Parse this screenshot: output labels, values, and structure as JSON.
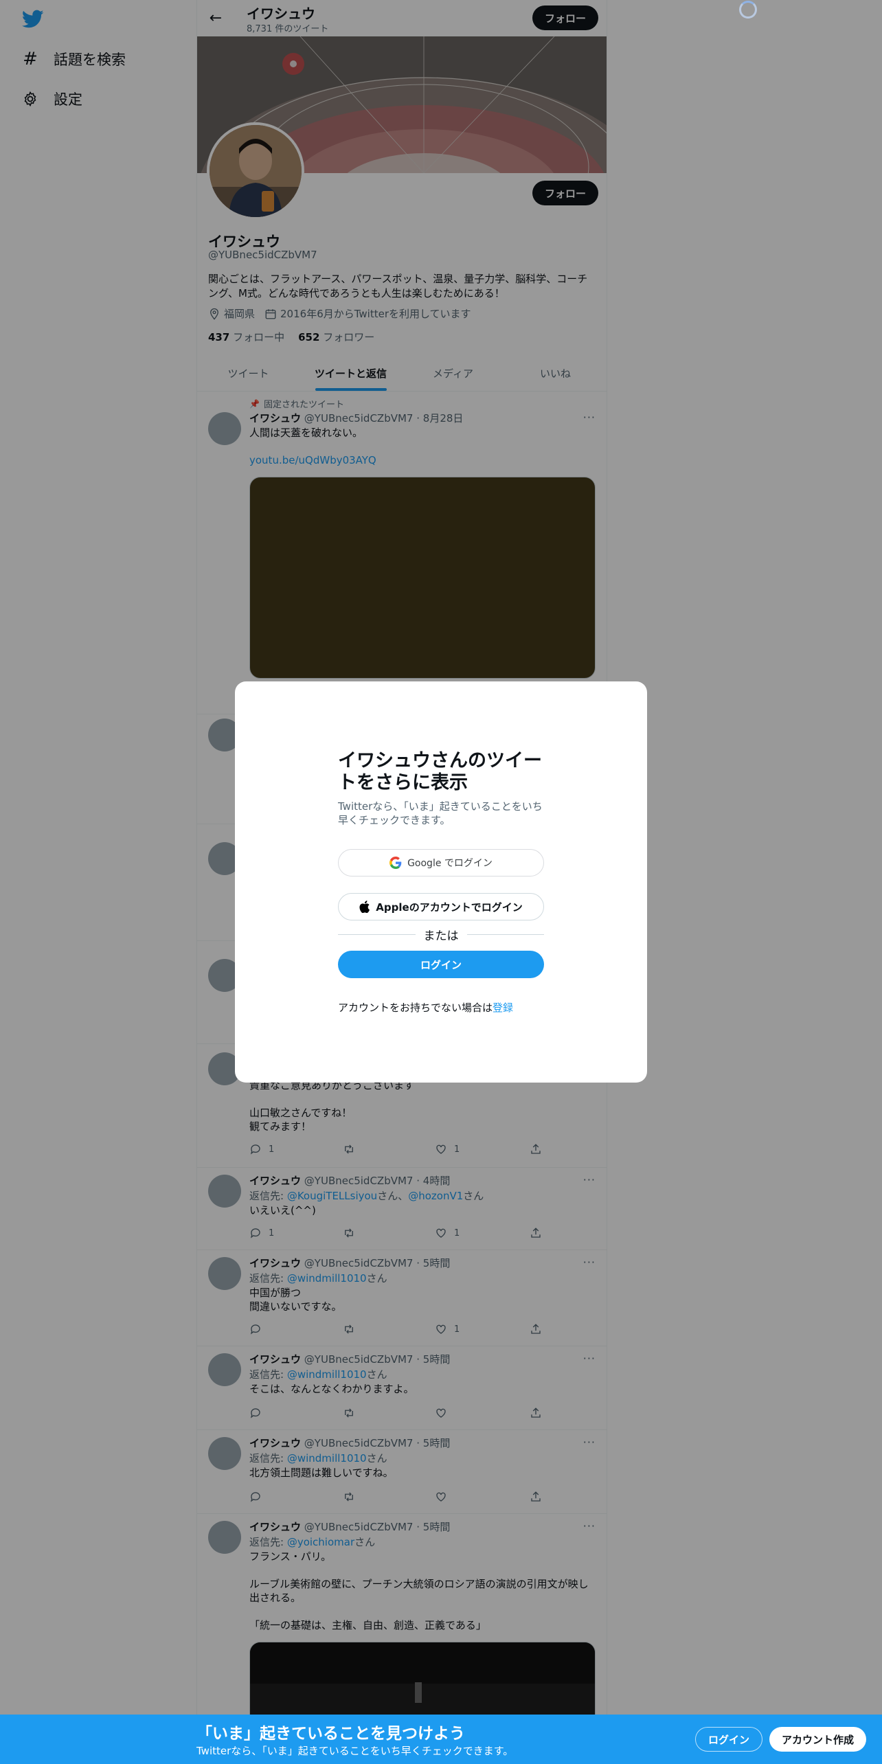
{
  "sidebar": {
    "items": [
      {
        "icon": "hashtag-icon",
        "label": "話題を検索"
      },
      {
        "icon": "gear-icon",
        "label": "設定"
      }
    ]
  },
  "header": {
    "name": "イワシュウ",
    "tweet_count": "8,731 件のツイート",
    "follow_label": "フォロー"
  },
  "profile": {
    "name": "イワシュウ",
    "handle": "@YUBnec5idCZbVM7",
    "bio": "関心ごとは、フラットアース、パワースポット、温泉、量子力学、脳科学、コーチング、M式。どんな時代であろうとも人生は楽しむためにある！",
    "location": "福岡県",
    "joined": "2016年6月からTwitterを利用しています",
    "following_count": "437",
    "following_label": "フォロー中",
    "followers_count": "652",
    "followers_label": "フォロワー",
    "follow_label": "フォロー"
  },
  "tabs": [
    {
      "label": "ツイート",
      "active": false
    },
    {
      "label": "ツイートと返信",
      "active": true
    },
    {
      "label": "メディア",
      "active": false
    },
    {
      "label": "いいね",
      "active": false
    }
  ],
  "pinned_label": "固定されたツイート",
  "pinned_tweet": {
    "name": "イワシュウ",
    "handle": "@YUBnec5idCZbVM7",
    "time": "8月28日",
    "text": "人間は天蓋を破れない。",
    "link": "youtu.be/uQdWby03AYQ"
  },
  "tweet_partial": {
    "text": "貴重なご意見ありがとうございます\n\n山口敏之さんですね！\n観てみます！",
    "reply_count": "1",
    "like_count": "1"
  },
  "tweets": [
    {
      "name": "イワシュウ",
      "handle": "@YUBnec5idCZbVM7",
      "time": "4時間",
      "reply_prefix": "返信先: ",
      "reply_to_1": "@KougiTELLsiyou",
      "reply_mid": "さん、",
      "reply_to_2": "@hozonV1",
      "reply_suffix": "さん",
      "text": "いえいえ(^^)",
      "reply_count": "1",
      "like_count": "1"
    },
    {
      "name": "イワシュウ",
      "handle": "@YUBnec5idCZbVM7",
      "time": "5時間",
      "reply_prefix": "返信先: ",
      "reply_to_1": "@windmill1010",
      "reply_suffix": "さん",
      "text": "中国が勝つ\n間違いないですな。",
      "reply_count": "",
      "like_count": "1"
    },
    {
      "name": "イワシュウ",
      "handle": "@YUBnec5idCZbVM7",
      "time": "5時間",
      "reply_prefix": "返信先: ",
      "reply_to_1": "@windmill1010",
      "reply_suffix": "さん",
      "text": "そこは、なんとなくわかりますよ。",
      "reply_count": "",
      "like_count": ""
    },
    {
      "name": "イワシュウ",
      "handle": "@YUBnec5idCZbVM7",
      "time": "5時間",
      "reply_prefix": "返信先: ",
      "reply_to_1": "@windmill1010",
      "reply_suffix": "さん",
      "text": "北方領土問題は難しいですね。",
      "reply_count": "",
      "like_count": ""
    },
    {
      "name": "イワシュウ",
      "handle": "@YUBnec5idCZbVM7",
      "time": "5時間",
      "reply_prefix": "返信先: ",
      "reply_to_1": "@yoichiomar",
      "reply_suffix": "さん",
      "text": "フランス・パリ。\n\nルーブル美術館の壁に、プーチン大統領のロシア語の演説の引用文が映し出される。\n\n「統一の基礎は、主権、自由、創造、正義である」"
    }
  ],
  "modal": {
    "title": "イワシュウさんのツイートをさらに表示",
    "subtitle": "Twitterなら、「いま」起きていることをいち早くチェックできます。",
    "google_label": "Google でログイン",
    "apple_label": "Appleのアカウントでログイン",
    "or_label": "または",
    "login_label": "ログイン",
    "signup_prefix": "アカウントをお持ちでない場合は",
    "signup_link": "登録"
  },
  "bottom_bar": {
    "title": "「いま」起きていることを見つけよう",
    "subtitle": "Twitterなら、「いま」起きていることをいち早くチェックできます。",
    "login_label": "ログイン",
    "signup_label": "アカウント作成"
  },
  "colors": {
    "accent": "#1d9bf0",
    "text": "#0f1419",
    "muted": "#536471"
  }
}
